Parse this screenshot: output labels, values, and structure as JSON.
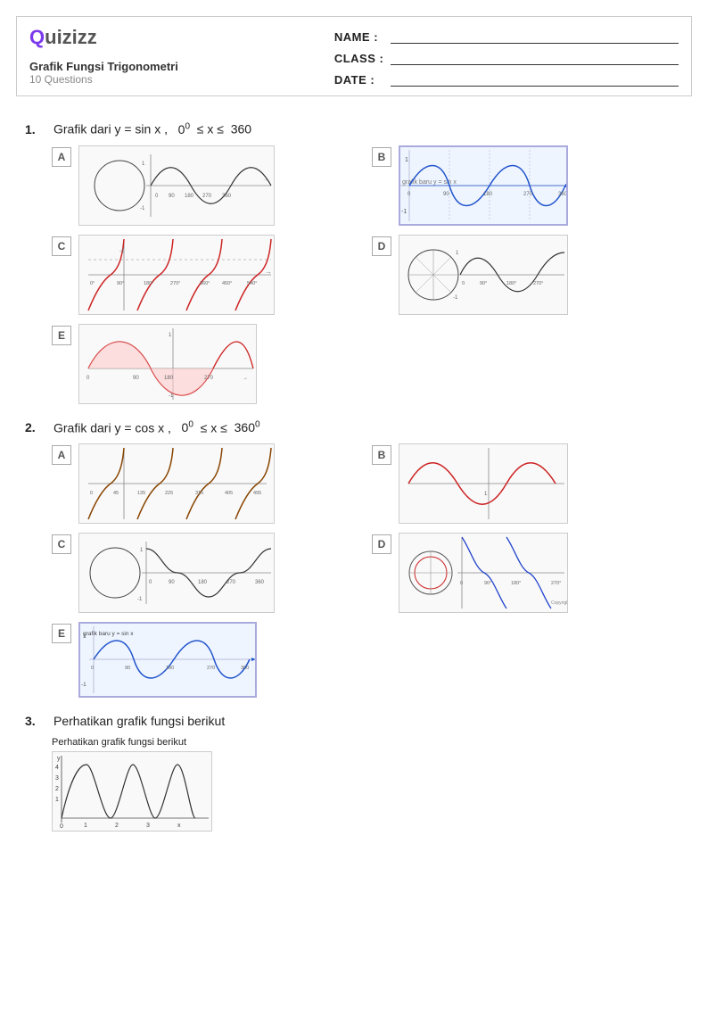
{
  "header": {
    "logo_text": "Quizizz",
    "title": "Grafik Fungsi Trigonometri",
    "subtitle": "10 Questions",
    "name_label": "NAME :",
    "class_label": "CLASS :",
    "date_label": "DATE :"
  },
  "questions": [
    {
      "number": "1.",
      "text": "Grafik dari y = sin x ,",
      "math": "0",
      "math2": "0",
      "inequality": "≤ x ≤ 360",
      "answers": [
        "A",
        "B",
        "C",
        "D",
        "E"
      ]
    },
    {
      "number": "2.",
      "text": "Grafik dari y = cos x ,",
      "math": "0",
      "math2": "0",
      "inequality": "≤ x ≤ 360",
      "answers": [
        "A",
        "B",
        "C",
        "D",
        "E"
      ]
    },
    {
      "number": "3.",
      "text": "Perhatikan grafik fungsi berikut"
    }
  ]
}
